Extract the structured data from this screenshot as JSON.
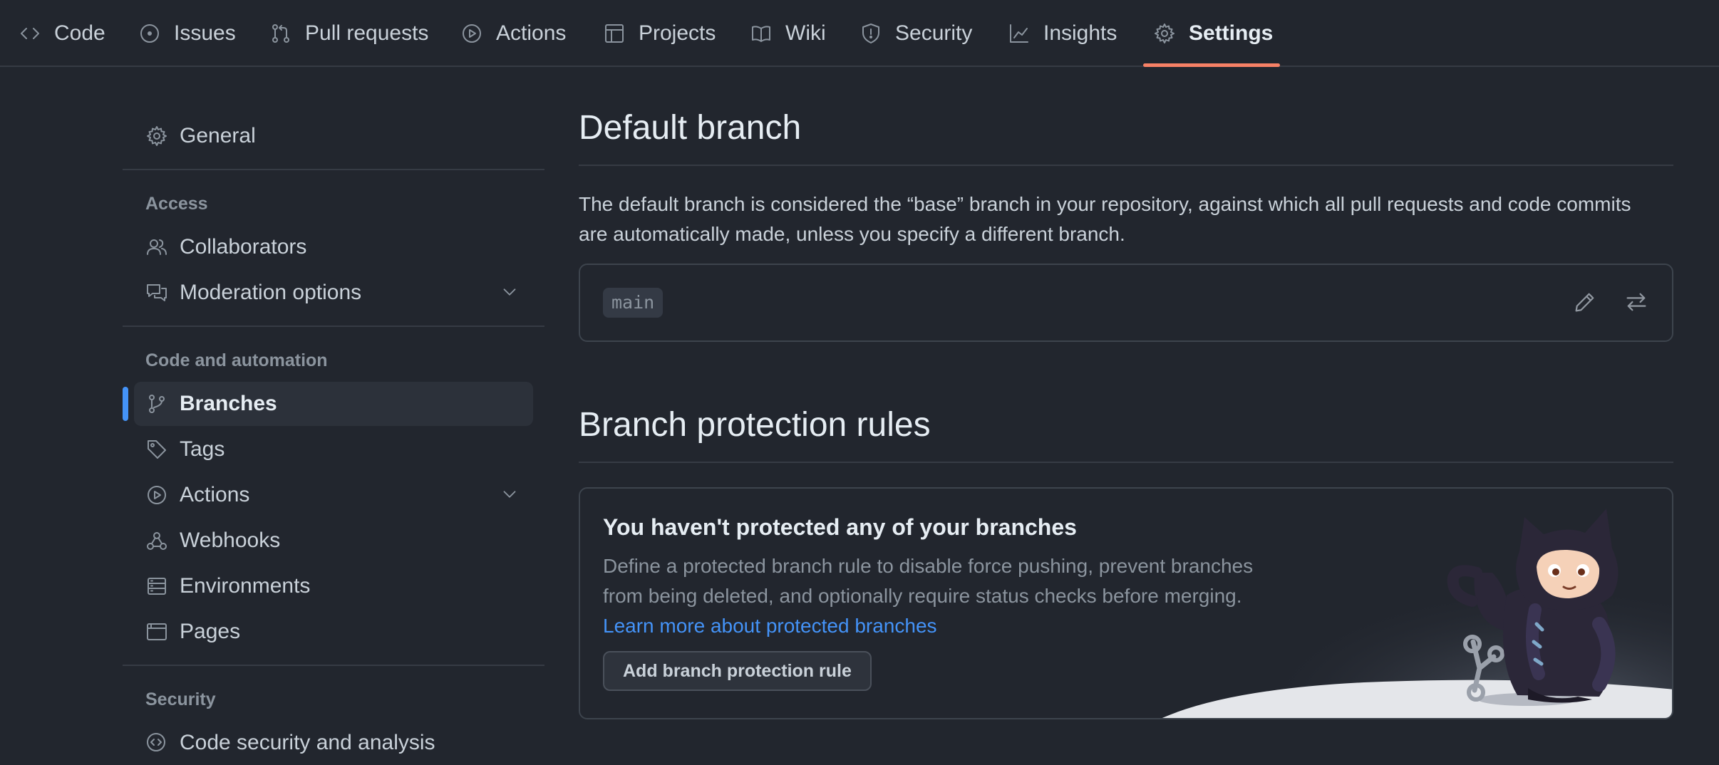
{
  "nav": {
    "tabs": [
      {
        "label": "Code",
        "icon": "code-icon"
      },
      {
        "label": "Issues",
        "icon": "issue-circle-icon"
      },
      {
        "label": "Pull requests",
        "icon": "pull-request-icon"
      },
      {
        "label": "Actions",
        "icon": "play-icon"
      },
      {
        "label": "Projects",
        "icon": "table-icon"
      },
      {
        "label": "Wiki",
        "icon": "book-icon"
      },
      {
        "label": "Security",
        "icon": "shield-icon"
      },
      {
        "label": "Insights",
        "icon": "graph-icon"
      },
      {
        "label": "Settings",
        "icon": "gear-icon",
        "active": true
      }
    ],
    "accent_color": "#f78166"
  },
  "sidebar": {
    "general": "General",
    "access_heading": "Access",
    "collaborators": "Collaborators",
    "moderation": "Moderation options",
    "code_automation_heading": "Code and automation",
    "branches": "Branches",
    "tags": "Tags",
    "actions": "Actions",
    "webhooks": "Webhooks",
    "environments": "Environments",
    "pages": "Pages",
    "security_heading": "Security",
    "code_security": "Code security and analysis",
    "active_indicator_color": "#4493f8"
  },
  "main": {
    "default_branch": {
      "title": "Default branch",
      "description": "The default branch is considered the “base” branch in your repository, against which all pull requests and code commits are automatically made, unless you specify a different branch.",
      "branch_name": "main"
    },
    "protection": {
      "title": "Branch protection rules",
      "empty_title": "You haven't protected any of your branches",
      "empty_description": "Define a protected branch rule to disable force pushing, prevent branches from being deleted, and optionally require status checks before merging.",
      "learn_more": "Learn more about protected branches",
      "add_button": "Add branch protection rule"
    }
  }
}
